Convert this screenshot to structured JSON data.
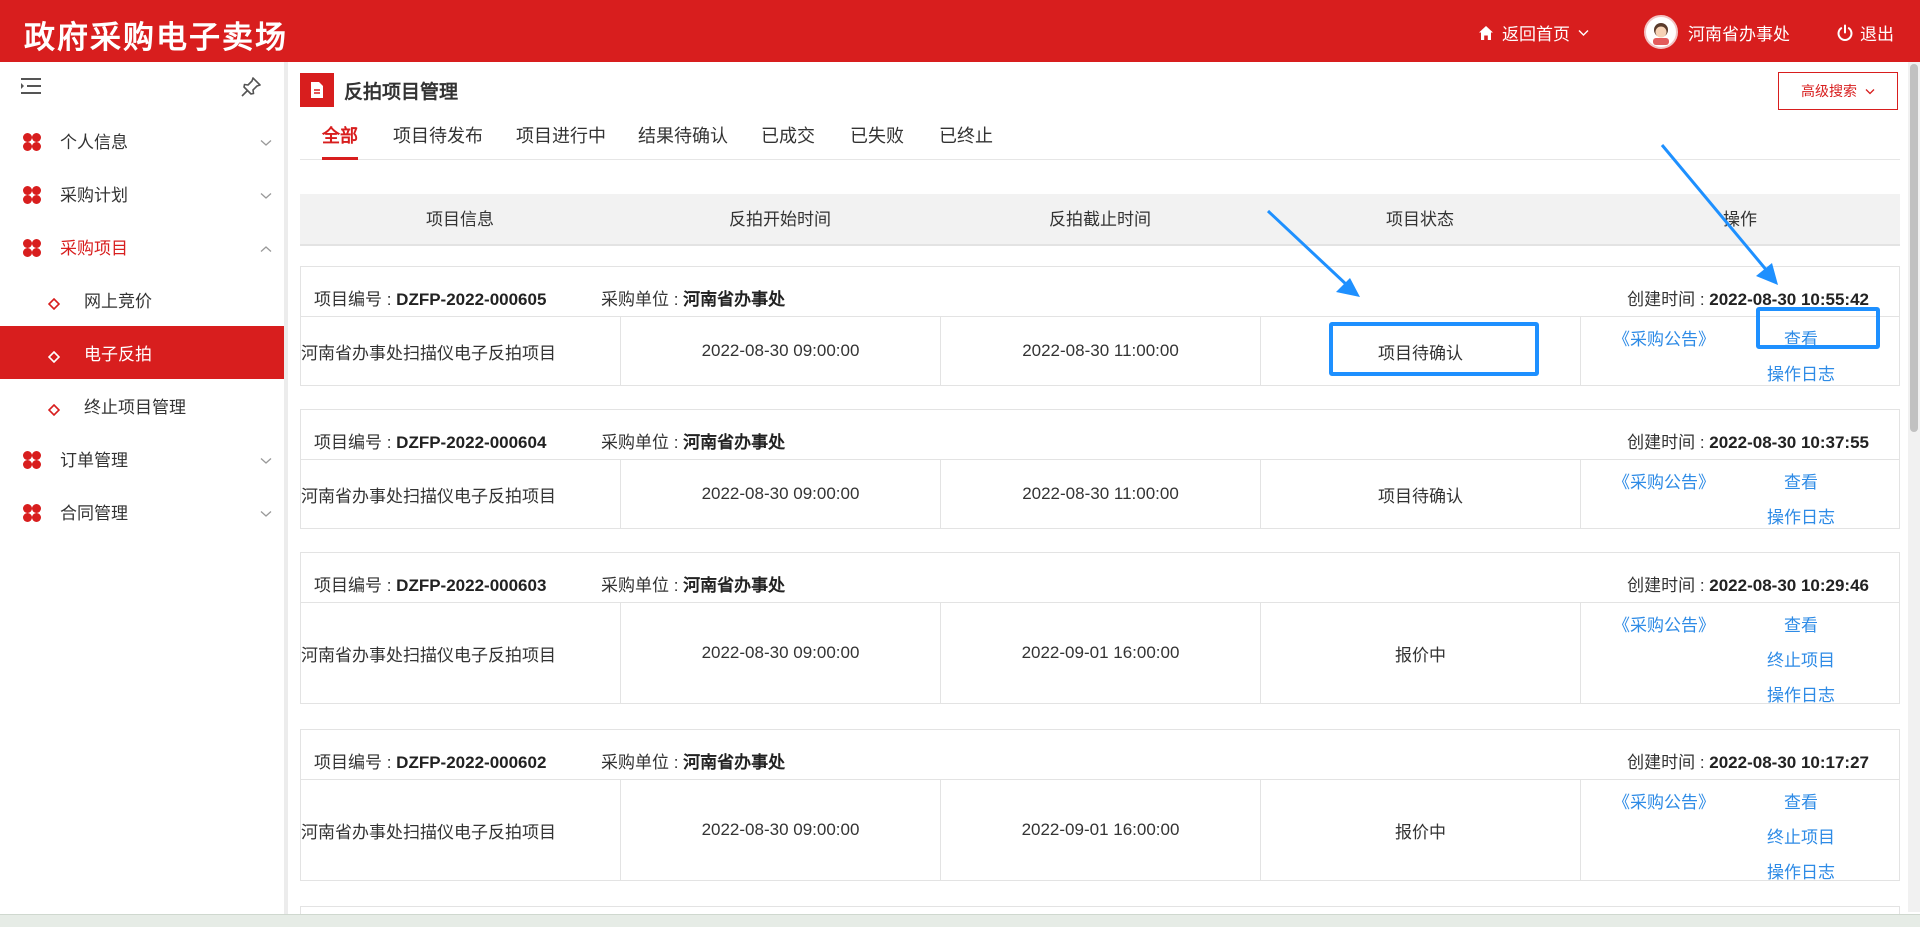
{
  "header": {
    "brand": "政府采购电子卖场",
    "home_label": "返回首页",
    "user_name": "河南省办事处",
    "logout_label": "退出"
  },
  "sidebar": {
    "items": [
      {
        "label": "个人信息",
        "state": "collapsed"
      },
      {
        "label": "采购计划",
        "state": "collapsed"
      },
      {
        "label": "采购项目",
        "state": "expanded",
        "children": [
          {
            "label": "网上竞价"
          },
          {
            "label": "电子反拍",
            "active": true
          },
          {
            "label": "终止项目管理"
          }
        ]
      },
      {
        "label": "订单管理",
        "state": "collapsed"
      },
      {
        "label": "合同管理",
        "state": "collapsed"
      }
    ]
  },
  "page": {
    "title": "反拍项目管理",
    "adv_search_label": "高级搜索",
    "tabs": [
      "全部",
      "项目待发布",
      "项目进行中",
      "结果待确认",
      "已成交",
      "已失败",
      "已终止"
    ],
    "active_tab": 0
  },
  "table": {
    "columns": [
      "项目信息",
      "反拍开始时间",
      "反拍截止时间",
      "项目状态",
      "操作"
    ],
    "labels": {
      "no": "项目编号 : ",
      "unit": "采购单位 : ",
      "ctime": "创建时间 : "
    },
    "rows": [
      {
        "no": "DZFP-2022-000605",
        "unit": "河南省办事处",
        "created": "2022-08-30 10:55:42",
        "name": "河南省办事处扫描仪电子反拍项目",
        "start": "2022-08-30 09:00:00",
        "end": "2022-08-30 11:00:00",
        "status": "项目待确认",
        "notice": "《采购公告》",
        "actions": [
          "查看",
          "操作日志"
        ]
      },
      {
        "no": "DZFP-2022-000604",
        "unit": "河南省办事处",
        "created": "2022-08-30 10:37:55",
        "name": "河南省办事处扫描仪电子反拍项目",
        "start": "2022-08-30 09:00:00",
        "end": "2022-08-30 11:00:00",
        "status": "项目待确认",
        "notice": "《采购公告》",
        "actions": [
          "查看",
          "操作日志"
        ]
      },
      {
        "no": "DZFP-2022-000603",
        "unit": "河南省办事处",
        "created": "2022-08-30 10:29:46",
        "name": "河南省办事处扫描仪电子反拍项目",
        "start": "2022-08-30 09:00:00",
        "end": "2022-09-01 16:00:00",
        "status": "报价中",
        "notice": "《采购公告》",
        "actions": [
          "查看",
          "终止项目",
          "操作日志"
        ]
      },
      {
        "no": "DZFP-2022-000602",
        "unit": "河南省办事处",
        "created": "2022-08-30 10:17:27",
        "name": "河南省办事处扫描仪电子反拍项目",
        "start": "2022-08-30 09:00:00",
        "end": "2022-09-01 16:00:00",
        "status": "报价中",
        "notice": "《采购公告》",
        "actions": [
          "查看",
          "终止项目",
          "操作日志"
        ]
      }
    ]
  },
  "colors": {
    "brand_red": "#d81e1e",
    "link_blue": "#2e8be6",
    "annotation_blue": "#1e90ff"
  }
}
